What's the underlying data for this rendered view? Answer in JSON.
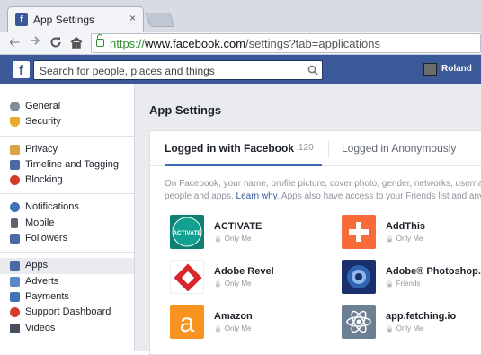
{
  "browser": {
    "tab_title": "App Settings",
    "tab_favicon": "f",
    "tab_close": "×",
    "url_scheme": "https://",
    "url_host": "www.facebook.com",
    "url_path": "/settings?tab=applications",
    "back_icon": "back-arrow-icon",
    "forward_icon": "forward-arrow-icon",
    "reload_icon": "reload-icon",
    "home_icon": "home-icon"
  },
  "fb_header": {
    "logo": "f",
    "search_placeholder": "Search for people, places and things",
    "user_name": "Roland",
    "brand_color": "#3b5998"
  },
  "sidebar": {
    "groups": [
      [
        {
          "label": "General",
          "icon": "gears-icon"
        },
        {
          "label": "Security",
          "icon": "shield-icon"
        }
      ],
      [
        {
          "label": "Privacy",
          "icon": "lock-icon"
        },
        {
          "label": "Timeline and Tagging",
          "icon": "timeline-icon"
        },
        {
          "label": "Blocking",
          "icon": "blocking-icon"
        }
      ],
      [
        {
          "label": "Notifications",
          "icon": "globe-icon"
        },
        {
          "label": "Mobile",
          "icon": "mobile-icon"
        },
        {
          "label": "Followers",
          "icon": "rss-icon"
        }
      ],
      [
        {
          "label": "Apps",
          "icon": "apps-icon",
          "active": true
        },
        {
          "label": "Adverts",
          "icon": "adverts-icon"
        },
        {
          "label": "Payments",
          "icon": "payments-icon"
        },
        {
          "label": "Support Dashboard",
          "icon": "lifebuoy-icon"
        },
        {
          "label": "Videos",
          "icon": "film-icon"
        }
      ]
    ]
  },
  "main": {
    "title": "App Settings",
    "tabs": [
      {
        "label": "Logged in with Facebook",
        "count": "120",
        "active": true
      },
      {
        "label": "Logged in Anonymously"
      }
    ],
    "desc_line1": "On Facebook, your name, profile picture, cover photo, gender, networks, usernam",
    "desc_line2_a": "people and apps. ",
    "desc_link": "Learn why",
    "desc_line2_b": ". Apps also have access to your Friends list and any in",
    "apps": [
      {
        "name": "ACTIVATE",
        "visibility": "Only Me",
        "logo": "activate-logo"
      },
      {
        "name": "AddThis",
        "visibility": "Only Me",
        "logo": "addthis-logo"
      },
      {
        "name": "Adobe Revel",
        "visibility": "Only Me",
        "logo": "adobe-revel-logo"
      },
      {
        "name": "Adobe® Photoshop...",
        "visibility": "Friends",
        "logo": "photoshop-logo"
      },
      {
        "name": "Amazon",
        "visibility": "Only Me",
        "logo": "amazon-logo"
      },
      {
        "name": "app.fetching.io",
        "visibility": "Only Me",
        "logo": "fetching-logo"
      }
    ]
  }
}
